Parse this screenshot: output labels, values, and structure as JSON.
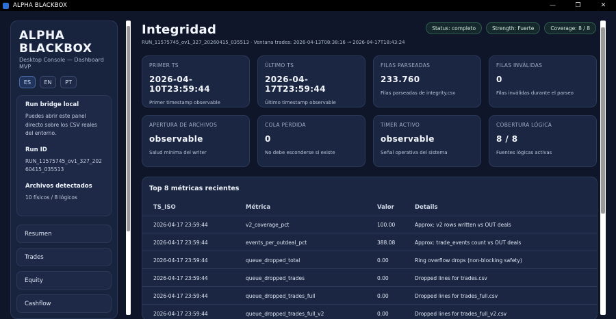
{
  "window": {
    "title": "ALPHA BLACKBOX",
    "minimize": "—",
    "maximize": "❐",
    "close": "✕"
  },
  "sidebar": {
    "brand_line1": "ALPHA",
    "brand_line2": "BLACKBOX",
    "subtitle": "Desktop Console — Dashboard MVP",
    "languages": [
      "ES",
      "EN",
      "PT"
    ],
    "active_language": "ES",
    "bridge_title": "Run bridge local",
    "bridge_text": "Puedes abrir este panel directo sobre los CSV reales del entorno.",
    "run_id_title": "Run ID",
    "run_id": "RUN_11575745_ov1_327_20260415_035513",
    "files_title": "Archivos detectados",
    "files_value": "10 físicos / 8 lógicos",
    "nav": [
      "Resumen",
      "Trades",
      "Equity",
      "Cashflow"
    ]
  },
  "header": {
    "title": "Integridad",
    "run_line": "RUN_11575745_ov1_327_20260415_035513 · Ventana trades: 2026-04-13T08:38:16 → 2026-04-17T18:43:24",
    "pills": [
      "Status: completo",
      "Strength: Fuerte",
      "Coverage: 8 / 8"
    ]
  },
  "cards": [
    {
      "label": "PRIMER TS",
      "value": "2026-04-10T23:59:44",
      "desc": "Primer timestamp observable"
    },
    {
      "label": "ÚLTIMO TS",
      "value": "2026-04-17T23:59:44",
      "desc": "Último timestamp observable"
    },
    {
      "label": "FILAS PARSEADAS",
      "value": "233.760",
      "desc": "Filas parseadas de integrity.csv"
    },
    {
      "label": "FILAS INVÁLIDAS",
      "value": "0",
      "desc": "Filas inválidas durante el parseo"
    },
    {
      "label": "APERTURA DE ARCHIVOS",
      "value": "observable",
      "desc": "Salud mínima del writer"
    },
    {
      "label": "COLA PERDIDA",
      "value": "0",
      "desc": "No debe esconderse si existe"
    },
    {
      "label": "TIMER ACTIVO",
      "value": "observable",
      "desc": "Señal operativa del sistema"
    },
    {
      "label": "COBERTURA LÓGICA",
      "value": "8 / 8",
      "desc": "Fuentes lógicas activas"
    }
  ],
  "table": {
    "title": "Top 8 métricas recientes",
    "columns": [
      "TS_ISO",
      "Métrica",
      "Valor",
      "Details"
    ],
    "rows": [
      [
        "2026-04-17 23:59:44",
        "v2_coverage_pct",
        "100.00",
        "Approx: v2 rows written vs OUT deals"
      ],
      [
        "2026-04-17 23:59:44",
        "events_per_outdeal_pct",
        "388.08",
        "Approx: trade_events count vs OUT deals"
      ],
      [
        "2026-04-17 23:59:44",
        "queue_dropped_total",
        "0.00",
        "Ring overflow drops (non-blocking safety)"
      ],
      [
        "2026-04-17 23:59:44",
        "queue_dropped_trades",
        "0.00",
        "Dropped lines for trades.csv"
      ],
      [
        "2026-04-17 23:59:44",
        "queue_dropped_trades_full",
        "0.00",
        "Dropped lines for trades_full.csv"
      ],
      [
        "2026-04-17 23:59:44",
        "queue_dropped_trades_full_v2",
        "0.00",
        "Dropped lines for trades_full_v2.csv"
      ]
    ]
  }
}
